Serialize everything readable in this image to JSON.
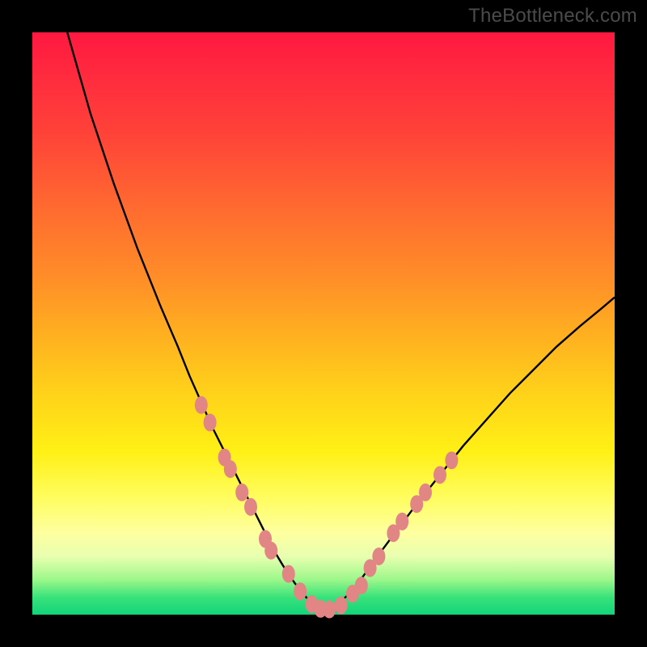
{
  "attribution": "TheBottleneck.com",
  "colors": {
    "background": "#000000",
    "curve": "#000000",
    "marker_fill": "#e18585",
    "marker_stroke": "#d46a6a",
    "gradient_top": "#ff1840",
    "gradient_bottom": "#12d47a"
  },
  "chart_data": {
    "type": "line",
    "title": "",
    "xlabel": "",
    "ylabel": "",
    "xlim": [
      0,
      100
    ],
    "ylim": [
      0,
      100
    ],
    "grid": false,
    "legend": false,
    "series": [
      {
        "name": "left-branch",
        "x": [
          6,
          10,
          14,
          18,
          22,
          25,
          27,
          29,
          31,
          33,
          35,
          37,
          38.5,
          40,
          41.5,
          43,
          45,
          47,
          49,
          50
        ],
        "values": [
          100,
          86,
          74,
          63,
          53,
          46,
          41,
          36.5,
          32,
          28,
          24,
          20,
          17,
          14,
          11,
          8.5,
          5.5,
          3,
          1.2,
          0.6
        ]
      },
      {
        "name": "right-branch",
        "x": [
          50,
          52,
          54,
          56,
          58,
          60,
          63,
          66,
          70,
          74,
          78,
          82,
          86,
          90,
          94,
          98,
          100
        ],
        "values": [
          0.6,
          1.4,
          3.2,
          5.5,
          8.2,
          11,
          15,
          19,
          24,
          29,
          33.5,
          38,
          42,
          46,
          49.5,
          52.8,
          54.5
        ]
      },
      {
        "name": "markers-left",
        "type": "scatter",
        "x": [
          29,
          30.5,
          33,
          34,
          36,
          37.5,
          40,
          41,
          44,
          46
        ],
        "values": [
          36,
          33,
          27,
          25,
          21,
          18.5,
          13,
          11,
          7,
          4
        ]
      },
      {
        "name": "markers-bottom",
        "type": "scatter",
        "x": [
          48,
          49.5,
          51,
          53,
          55,
          56.5
        ],
        "values": [
          1.8,
          1.0,
          0.9,
          1.6,
          3.6,
          5.0
        ]
      },
      {
        "name": "markers-right",
        "type": "scatter",
        "x": [
          58,
          59.5,
          62,
          63.5,
          66,
          67.5,
          70,
          72
        ],
        "values": [
          8,
          10,
          14,
          16,
          19,
          21,
          24,
          26.5
        ]
      }
    ]
  }
}
